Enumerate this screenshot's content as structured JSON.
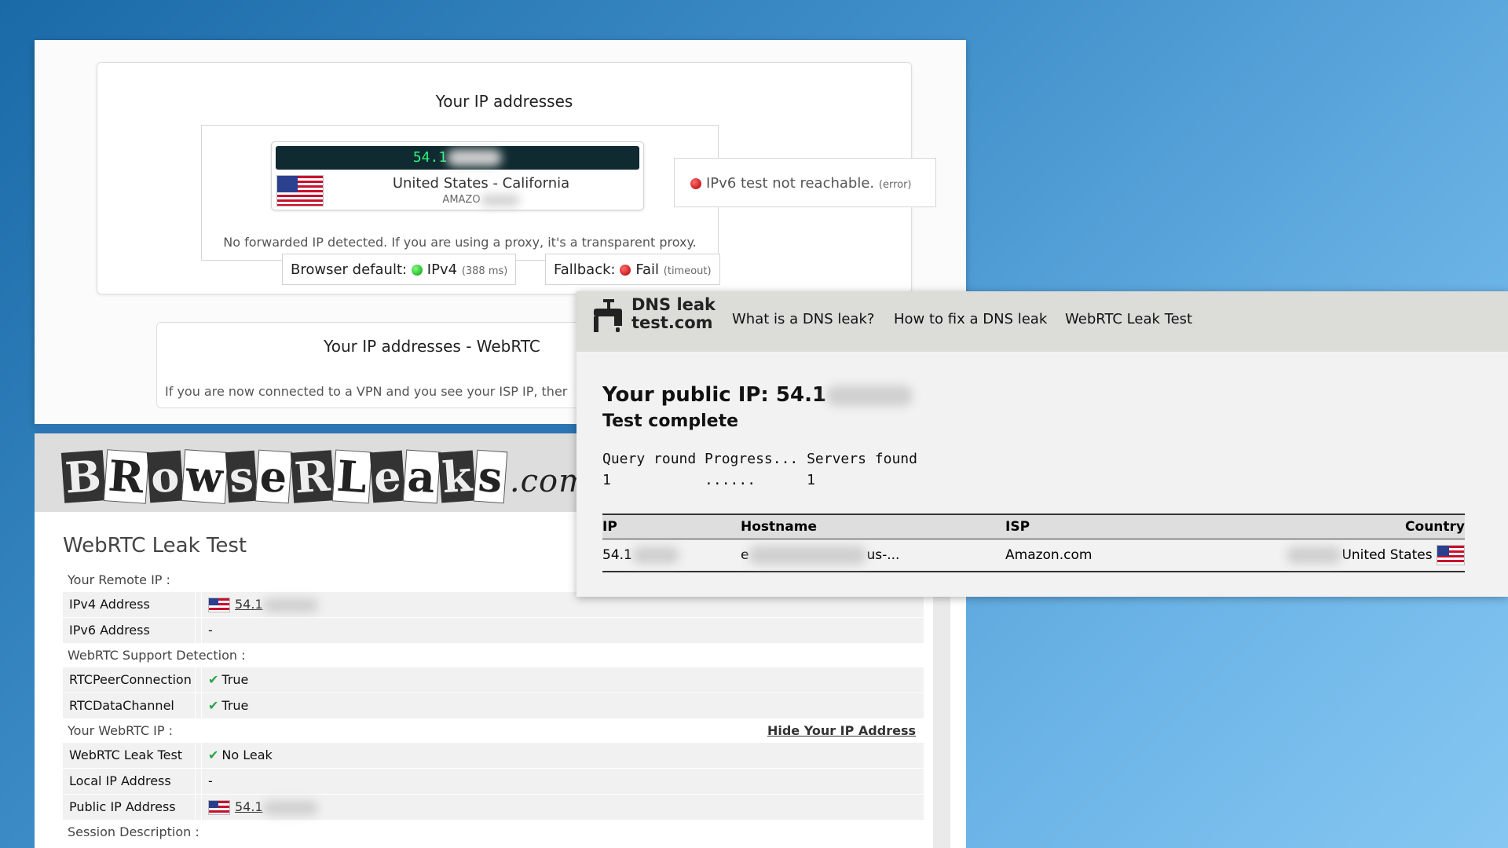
{
  "panel1": {
    "title": "Your IP addresses",
    "ip_prefix": "54.1",
    "location": "United States - California",
    "isp_prefix": "AMAZO",
    "forward_note": "No forwarded IP detected. If you are using a proxy, it's a transparent proxy.",
    "ipv6_status": "IPv6 test not reachable.",
    "ipv6_detail": "(error)",
    "browser_default_label": "Browser default:",
    "browser_default_value": "IPv4",
    "browser_default_detail": "(388 ms)",
    "fallback_label": "Fallback:",
    "fallback_value": "Fail",
    "fallback_detail": "(timeout)",
    "webrtc_title": "Your IP addresses - WebRTC",
    "webrtc_note": "If you are now connected to a VPN and you see your ISP IP, ther"
  },
  "panel2": {
    "page_title": "WebRTC Leak Test",
    "remote_ip_section": "Your Remote IP :",
    "ipv4_label": "IPv4 Address",
    "ipv4_value": "54.1",
    "ipv6_label": "IPv6 Address",
    "ipv6_value": "-",
    "support_section": "WebRTC Support Detection :",
    "rtcpeer_label": "RTCPeerConnection",
    "rtcpeer_value": "True",
    "rtcdata_label": "RTCDataChannel",
    "rtcdata_value": "True",
    "webrtc_ip_section": "Your WebRTC IP :",
    "hide_link": "Hide Your IP Address",
    "leak_label": "WebRTC Leak Test",
    "leak_value": "No Leak",
    "local_label": "Local IP Address",
    "local_value": "-",
    "public_label": "Public IP Address",
    "public_value": "54.1",
    "session_section": "Session Description :"
  },
  "panel3": {
    "brand_line1": "DNS leak",
    "brand_line2": "test.com",
    "nav": [
      "What is a DNS leak?",
      "How to fix a DNS leak",
      "WebRTC Leak Test"
    ],
    "public_ip_label": "Your public IP: 54.1",
    "test_status": "Test complete",
    "progress_header": "Query round Progress... Servers found",
    "progress_values": "1           ......      1",
    "table_headers": [
      "IP",
      "Hostname",
      "ISP",
      "Country"
    ],
    "row": {
      "ip": "54.1",
      "hostname_prefix": "e",
      "hostname_suffix": "us-...",
      "isp": "Amazon.com",
      "country": "United States"
    }
  },
  "colors": {
    "accent_blue": "#2b75b4",
    "status_green": "#0a9a0a",
    "status_red": "#b00000",
    "ip_bar_text": "#2cf27a"
  },
  "icons": [
    "us-flag-icon",
    "red-status-dot-icon",
    "green-status-dot-icon",
    "check-icon",
    "faucet-icon"
  ]
}
